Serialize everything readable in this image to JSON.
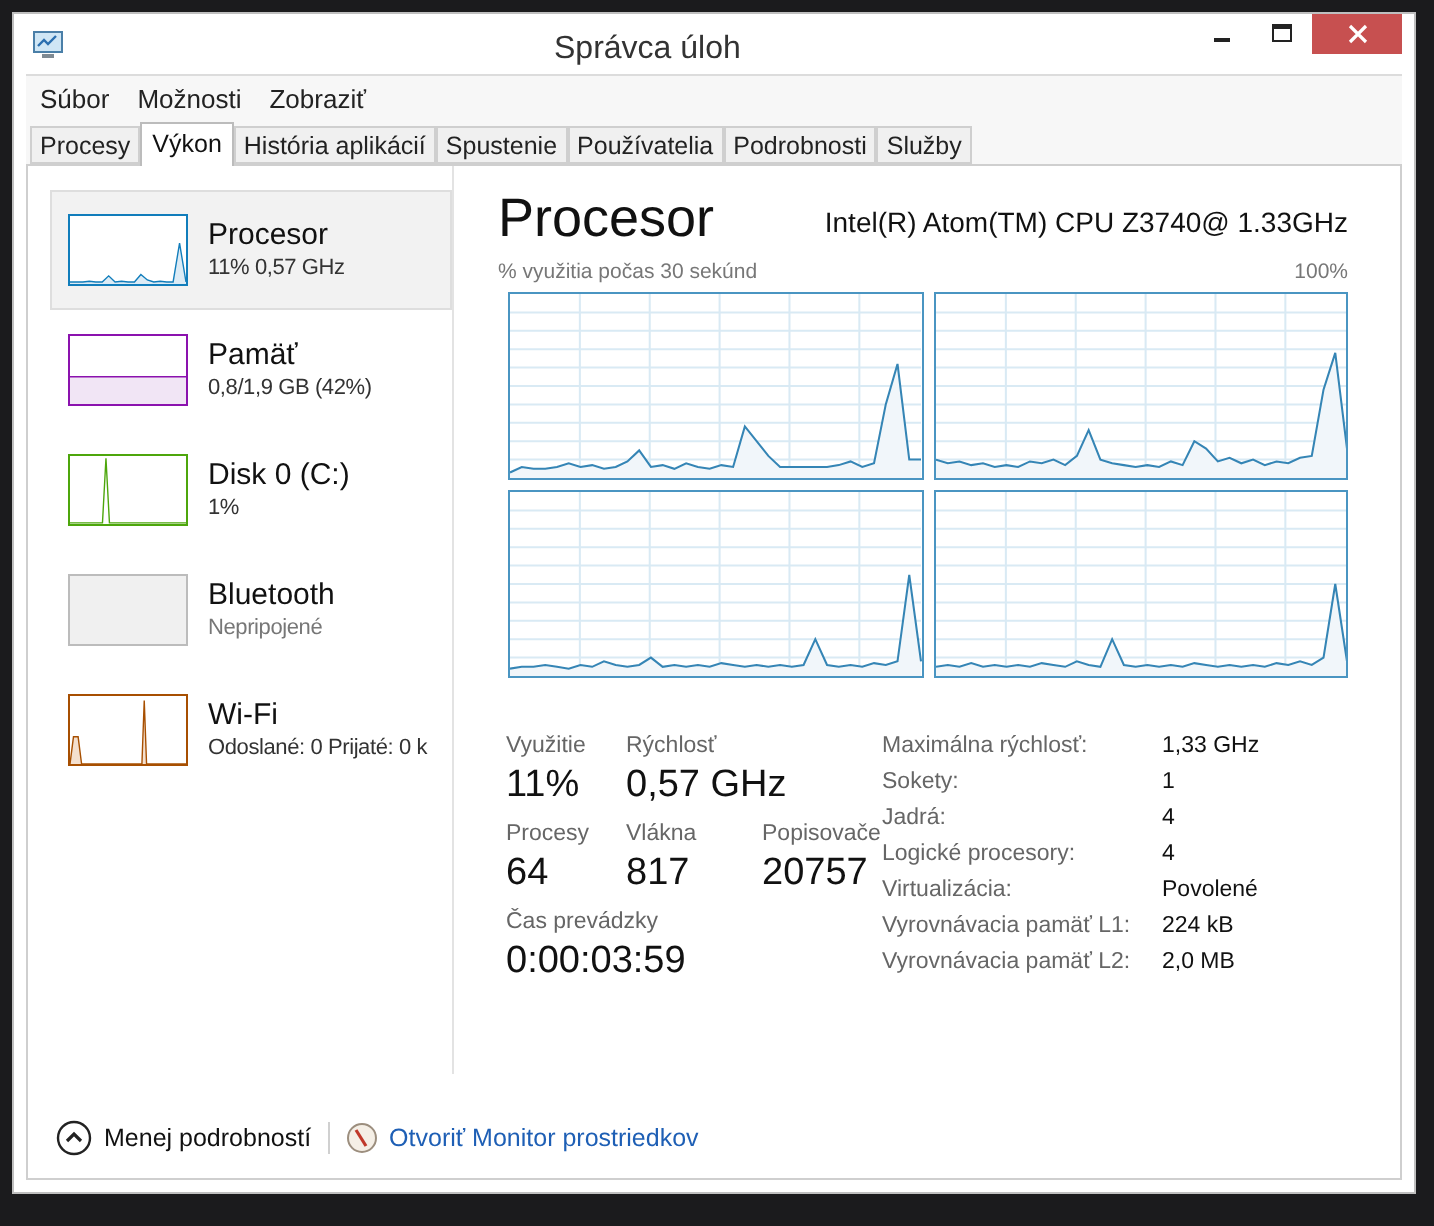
{
  "window": {
    "title": "Správca úloh"
  },
  "menu": [
    "Súbor",
    "Možnosti",
    "Zobraziť"
  ],
  "tabs": [
    {
      "label": "Procesy",
      "selected": false
    },
    {
      "label": "Výkon",
      "selected": true
    },
    {
      "label": "História aplikácií",
      "selected": false
    },
    {
      "label": "Spustenie",
      "selected": false
    },
    {
      "label": "Používatelia",
      "selected": false
    },
    {
      "label": "Podrobnosti",
      "selected": false
    },
    {
      "label": "Služby",
      "selected": false
    }
  ],
  "sidebar": {
    "items": [
      {
        "kind": "cpu",
        "name": "Procesor",
        "detail": "11% 0,57 GHz",
        "color": "#117dbb",
        "selected": true
      },
      {
        "kind": "memory",
        "name": "Pamäť",
        "detail": "0,8/1,9 GB (42%)",
        "color": "#8b12ae",
        "selected": false
      },
      {
        "kind": "disk",
        "name": "Disk 0 (C:)",
        "detail": "1%",
        "color": "#4da60c",
        "selected": false
      },
      {
        "kind": "bluetooth",
        "name": "Bluetooth",
        "detail": "Nepripojené",
        "color": "#bcbcbc",
        "selected": false
      },
      {
        "kind": "wifi",
        "name": "Wi-Fi",
        "detail": "Odoslané: 0 Prijaté: 0 k",
        "color": "#a74f01",
        "selected": false
      }
    ]
  },
  "main": {
    "title": "Procesor",
    "model": "Intel(R) Atom(TM) CPU Z3740@ 1.33GHz",
    "graph_label": "% využitia počas 30 sekúnd",
    "graph_max": "100%",
    "stats": [
      {
        "label": "Využitie",
        "value": "11%"
      },
      {
        "label": "Rýchlosť",
        "value": "0,57 GHz"
      },
      {
        "label": "Procesy",
        "value": "64"
      },
      {
        "label": "Vlákna",
        "value": "817"
      },
      {
        "label": "Popisovače",
        "value": "20757"
      },
      {
        "label": "Čas prevádzky",
        "value": "0:00:03:59"
      }
    ],
    "specs": [
      {
        "label": "Maximálna rýchlosť:",
        "value": "1,33 GHz"
      },
      {
        "label": "Sokety:",
        "value": "1"
      },
      {
        "label": "Jadrá:",
        "value": "4"
      },
      {
        "label": "Logické procesory:",
        "value": "4"
      },
      {
        "label": "Virtualizácia:",
        "value": "Povolené"
      },
      {
        "label": "Vyrovnávacia pamäť L1:",
        "value": "224 kB"
      },
      {
        "label": "Vyrovnávacia pamäť L2:",
        "value": "2,0 MB"
      }
    ]
  },
  "footer": {
    "details_button": "Menej podrobností",
    "monitor_link": "Otvoriť Monitor prostriedkov"
  }
}
